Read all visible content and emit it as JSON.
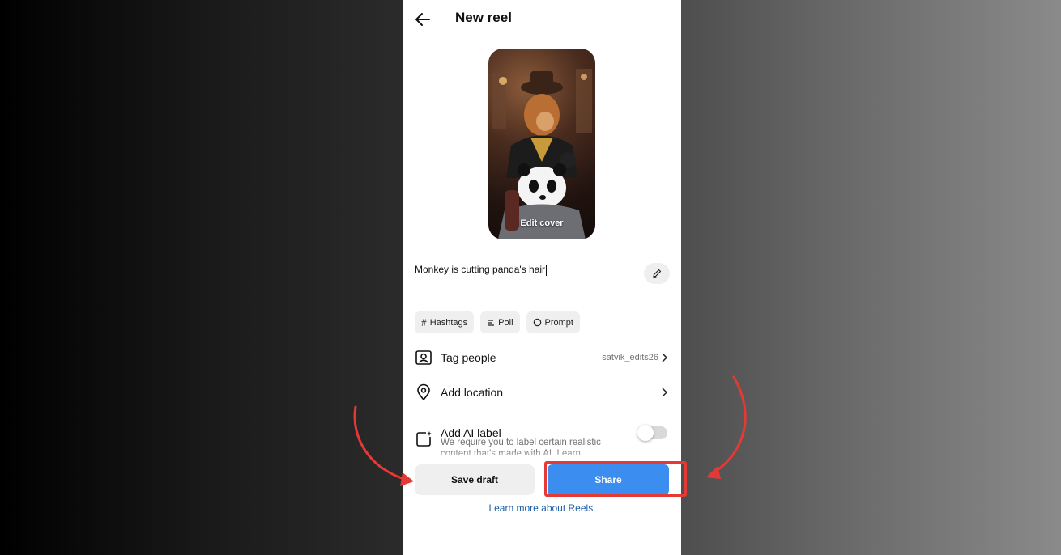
{
  "header": {
    "title": "New reel",
    "back_icon": "arrow-left-icon"
  },
  "cover": {
    "label": "Edit cover"
  },
  "caption": {
    "text": "Monkey is cutting panda's hair"
  },
  "chips": [
    {
      "label": "Hashtags",
      "icon": "hash-icon"
    },
    {
      "label": "Poll",
      "icon": "poll-icon"
    },
    {
      "label": "Prompt",
      "icon": "prompt-icon"
    }
  ],
  "options": {
    "tag_people": {
      "label": "Tag people",
      "value": "satvik_edits26"
    },
    "add_location": {
      "label": "Add location"
    },
    "ai_label": {
      "label": "Add AI label",
      "description": "We require you to label certain realistic content that's made with AI. Learn",
      "enabled": false
    }
  },
  "actions": {
    "save_draft": "Save draft",
    "share": "Share"
  },
  "footer": {
    "learn_more": "Learn more about Reels."
  },
  "colors": {
    "share": "#3b8df0",
    "annotation": "#e53935"
  }
}
